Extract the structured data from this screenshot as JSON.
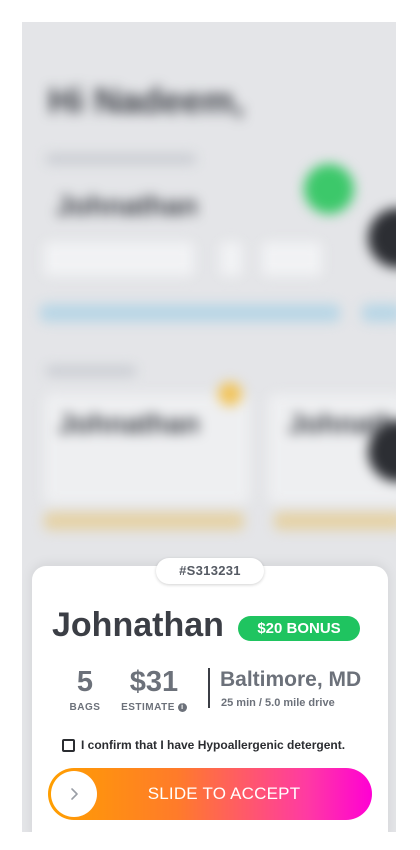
{
  "order": {
    "id": "#S313231"
  },
  "customer": {
    "name": "Johnathan",
    "bonus": "$20 BONUS"
  },
  "stats": {
    "bags_value": "5",
    "bags_label": "BAGS",
    "estimate_value": "$31",
    "estimate_label": "ESTIMATE"
  },
  "location": {
    "city": "Baltimore, MD",
    "drive": "25 min / 5.0 mile drive"
  },
  "confirm": {
    "label": "I confirm that I have Hypoallergenic detergent.",
    "checked": false
  },
  "slider": {
    "label": "SLIDE TO ACCEPT",
    "knob_icon": "chevron-right-icon"
  },
  "colors": {
    "bonus_green": "#1fc460",
    "slider_start": "#ff9f00",
    "slider_end": "#ff00d4",
    "text_dark": "#3b3e45",
    "text_muted": "#6c717a"
  }
}
